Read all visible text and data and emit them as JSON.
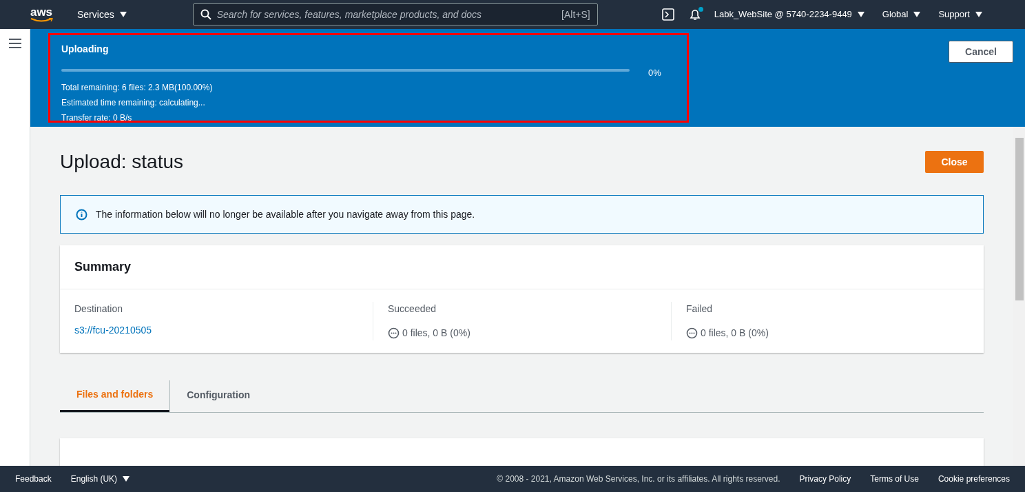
{
  "top_nav": {
    "logo": "aws",
    "services": "Services",
    "search": {
      "placeholder": "Search for services, features, marketplace products, and docs",
      "shortcut": "[Alt+S]"
    },
    "notifications_unread": true,
    "account": "Labk_WebSite @ 5740-2234-9449",
    "region": "Global",
    "support": "Support"
  },
  "upload_banner": {
    "title": "Uploading",
    "level": 0,
    "percent": "0%",
    "lines": [
      "Total remaining: 6 files: 2.3 MB(100.00%)",
      "Estimated time remaining: calculating...",
      "Transfer rate: 0 B/s"
    ],
    "highlighted": true,
    "cancel": "Cancel"
  },
  "page": {
    "title": "Upload: status",
    "close": "Close",
    "info": "The information below will no longer be available after you navigate away from this page.",
    "summary": {
      "title": "Summary",
      "columns": [
        {
          "label": "Destination",
          "kind": "link",
          "value": "s3://fcu-20210505"
        },
        {
          "label": "Succeeded",
          "kind": "status",
          "value": "0 files, 0 B (0%)"
        },
        {
          "label": "Failed",
          "kind": "status",
          "value": "0 files, 0 B (0%)"
        }
      ]
    },
    "tabs": [
      {
        "label": "Files and folders",
        "selected": true
      },
      {
        "label": "Configuration",
        "selected": false
      }
    ]
  },
  "footer": {
    "feedback": "Feedback",
    "language": "English (UK)",
    "copyright": "© 2008 - 2021, Amazon Web Services, Inc. or its affiliates. All rights reserved.",
    "links": [
      "Privacy Policy",
      "Terms of Use",
      "Cookie preferences"
    ]
  }
}
